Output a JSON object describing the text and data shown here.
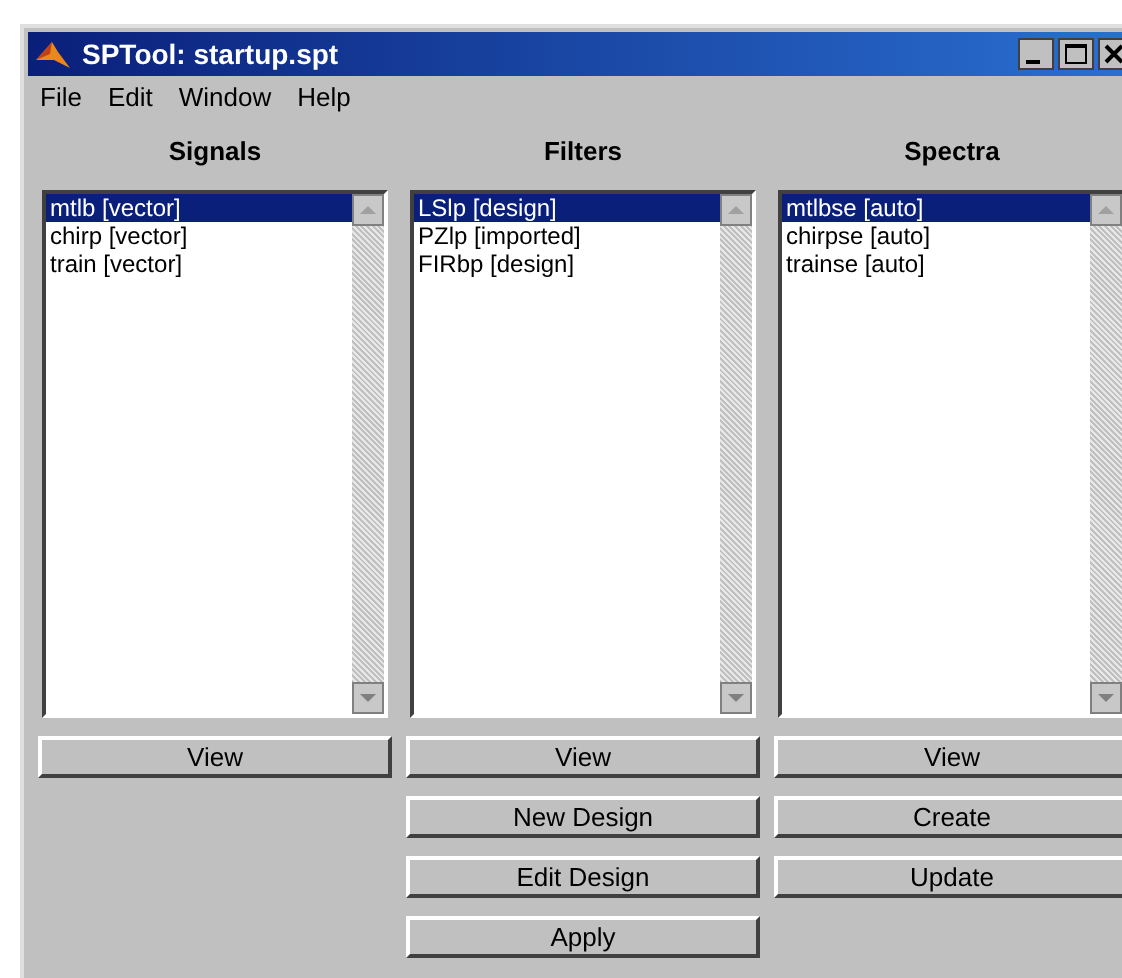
{
  "window": {
    "title": "SPTool: startup.spt"
  },
  "menu": [
    "File",
    "Edit",
    "Window",
    "Help"
  ],
  "columns": [
    {
      "title": "Signals",
      "items": [
        {
          "label": "mtlb [vector]",
          "selected": true
        },
        {
          "label": "chirp [vector]",
          "selected": false
        },
        {
          "label": "train [vector]",
          "selected": false
        }
      ],
      "buttons": [
        "View"
      ]
    },
    {
      "title": "Filters",
      "items": [
        {
          "label": "LSlp [design]",
          "selected": true
        },
        {
          "label": "PZlp [imported]",
          "selected": false
        },
        {
          "label": "FIRbp [design]",
          "selected": false
        }
      ],
      "buttons": [
        "View",
        "New Design",
        "Edit Design",
        "Apply"
      ]
    },
    {
      "title": "Spectra",
      "items": [
        {
          "label": "mtlbse [auto]",
          "selected": true
        },
        {
          "label": "chirpse [auto]",
          "selected": false
        },
        {
          "label": "trainse [auto]",
          "selected": false
        }
      ],
      "buttons": [
        "View",
        "Create",
        "Update"
      ]
    }
  ]
}
